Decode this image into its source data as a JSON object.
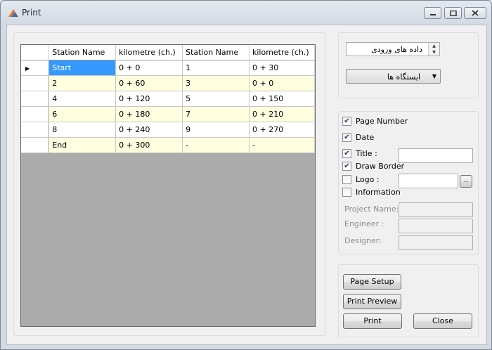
{
  "window": {
    "title": "Print"
  },
  "grid": {
    "columns": [
      "Station Name",
      "kilometre (ch.)",
      "Station Name",
      "kilometre (ch.)"
    ],
    "rows": [
      [
        "Start",
        "0 + 0",
        "1",
        "0 + 30"
      ],
      [
        "2",
        "0 + 60",
        "3",
        "0 + 0"
      ],
      [
        "4",
        "0 + 120",
        "5",
        "0 + 150"
      ],
      [
        "6",
        "0 + 180",
        "7",
        "0 + 210"
      ],
      [
        "8",
        "0 + 240",
        "9",
        "0 + 270"
      ],
      [
        "End",
        "0 + 300",
        "-",
        "-"
      ]
    ],
    "current_row_glyph": "▶"
  },
  "options": {
    "input_data_spinner": "داده های ورودی",
    "stations_combo": "ایستگاه ها"
  },
  "print_options": {
    "page_number": {
      "label": "Page Number",
      "checked": true
    },
    "date": {
      "label": "Date",
      "checked": true
    },
    "title": {
      "label": "Title :",
      "checked": true,
      "value": ""
    },
    "draw_border": {
      "label": "Draw Border",
      "checked": true
    },
    "logo": {
      "label": "Logo :",
      "checked": false,
      "value": "",
      "browse_label": ".."
    },
    "information": {
      "label": "Information",
      "checked": false
    },
    "project_name": {
      "label": "Project Name:",
      "value": ""
    },
    "engineer": {
      "label": "Engineer :",
      "value": ""
    },
    "designer": {
      "label": "Designer:",
      "value": ""
    },
    "check_glyph": "✔"
  },
  "actions": {
    "page_setup": "Page Setup",
    "print_preview": "Print Preview",
    "print": "Print",
    "close": "Close"
  }
}
